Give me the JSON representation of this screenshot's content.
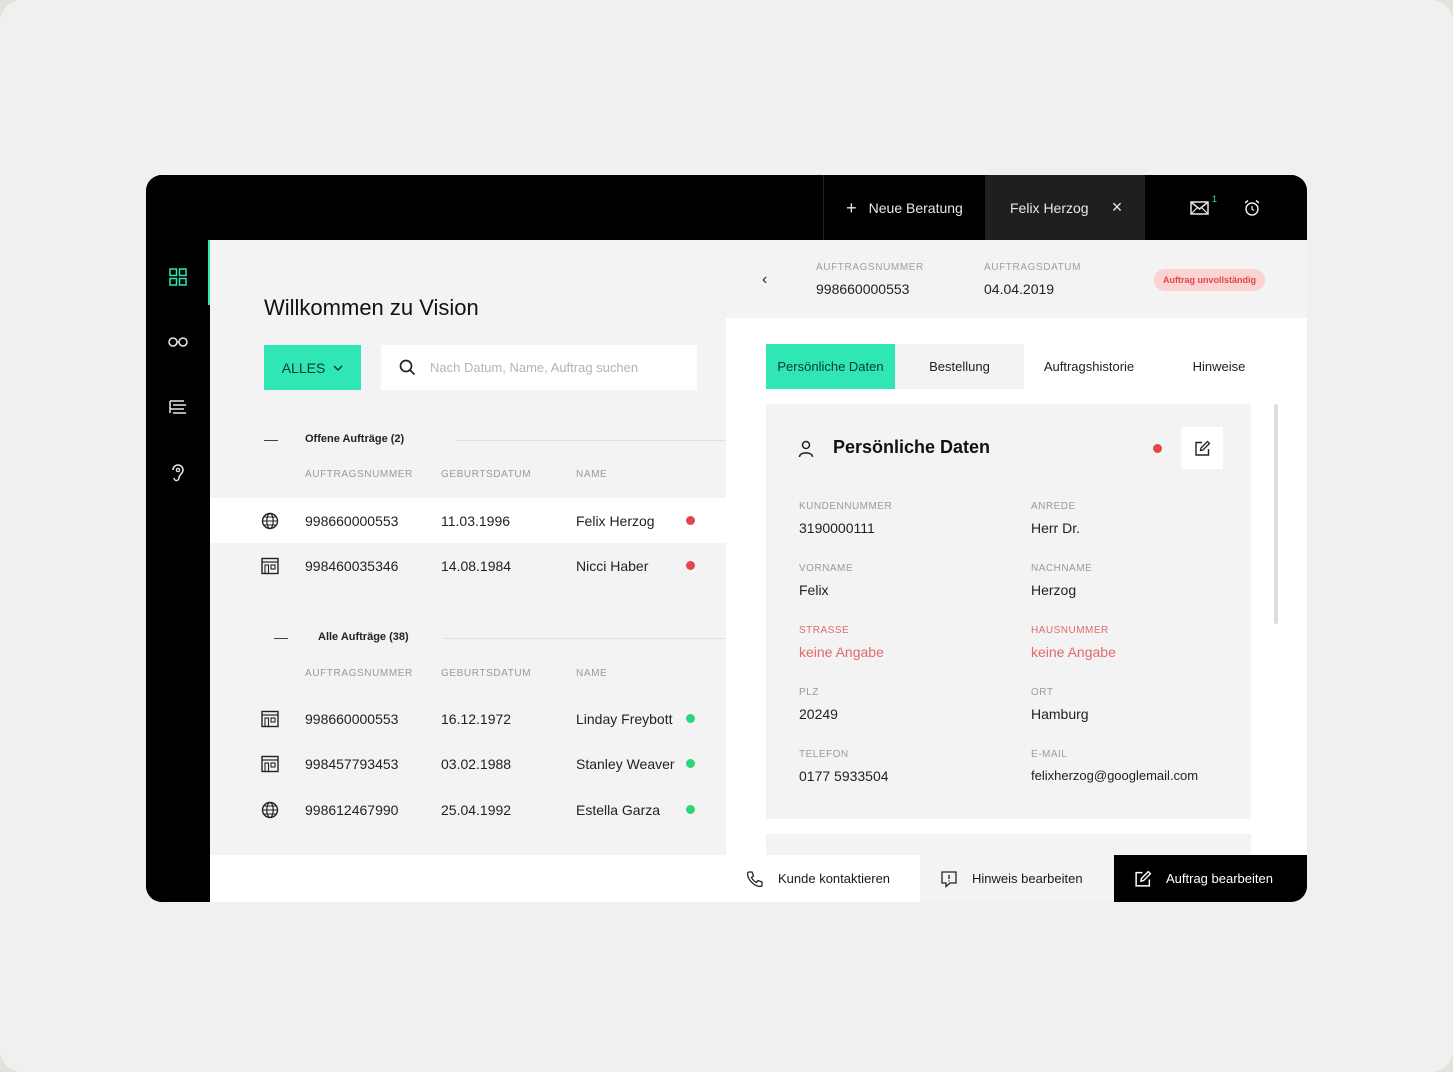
{
  "colors": {
    "accent": "#2fe6b4",
    "error": "#e04848",
    "success": "#2ed47a"
  },
  "topbar": {
    "new_consultation": "Neue Beratung",
    "open_tab": "Felix Herzog",
    "mail_badge": "1"
  },
  "sidebar": {
    "items": [
      "dashboard-icon",
      "glasses-icon",
      "list-icon",
      "hearing-icon"
    ]
  },
  "left": {
    "title": "Willkommen zu Vision",
    "filter": "ALLES",
    "search_placeholder": "Nach Datum, Name, Auftrag suchen",
    "open_section": {
      "label": "Offene Aufträge (2)",
      "columns": [
        "AUFTRAGSNUMMER",
        "GEBURTSDATUM",
        "NAME"
      ],
      "rows": [
        {
          "icon": "globe-icon",
          "number": "998660000553",
          "dob": "11.03.1996",
          "name": "Felix Herzog",
          "status": "error"
        },
        {
          "icon": "store-icon",
          "number": "998460035346",
          "dob": "14.08.1984",
          "name": "Nicci Haber",
          "status": "error"
        }
      ]
    },
    "all_section": {
      "label": "Alle Aufträge (38)",
      "columns": [
        "AUFTRAGSNUMMER",
        "GEBURTSDATUM",
        "NAME"
      ],
      "rows": [
        {
          "icon": "store-icon",
          "number": "998660000553",
          "dob": "16.12.1972",
          "name": "Linday Freybott",
          "status": "success"
        },
        {
          "icon": "store-icon",
          "number": "998457793453",
          "dob": "03.02.1988",
          "name": "Stanley Weaver",
          "status": "success"
        },
        {
          "icon": "globe-icon",
          "number": "998612467990",
          "dob": "25.04.1992",
          "name": "Estella Garza",
          "status": "success"
        }
      ]
    }
  },
  "right": {
    "order_number_label": "AUFTRAGSNUMMER",
    "order_number": "998660000553",
    "order_date_label": "AUFTRAGSDATUM",
    "order_date": "04.04.2019",
    "status_badge": "Auftrag unvollständig",
    "tabs": [
      "Persönliche Daten",
      "Bestellung",
      "Auftragshistorie",
      "Hinweise"
    ],
    "card": {
      "title": "Persönliche Daten",
      "fields": [
        {
          "label": "KUNDENNUMMER",
          "value": "3190000111"
        },
        {
          "label": "ANREDE",
          "value": "Herr Dr."
        },
        {
          "label": "VORNAME",
          "value": "Felix"
        },
        {
          "label": "NACHNAME",
          "value": "Herzog"
        },
        {
          "label": "STRASSE",
          "value": "keine Angabe"
        },
        {
          "label": "HAUSNUMMER",
          "value": "keine Angabe"
        },
        {
          "label": "PLZ",
          "value": "20249"
        },
        {
          "label": "ORT",
          "value": "Hamburg"
        },
        {
          "label": "TELEFON",
          "value": "0177 5933504"
        },
        {
          "label": "E-MAIL",
          "value": "felixherzog@googlemail.com"
        }
      ]
    },
    "actions": [
      "Kunde kontaktieren",
      "Hinweis bearbeiten",
      "Auftrag bearbeiten"
    ]
  }
}
